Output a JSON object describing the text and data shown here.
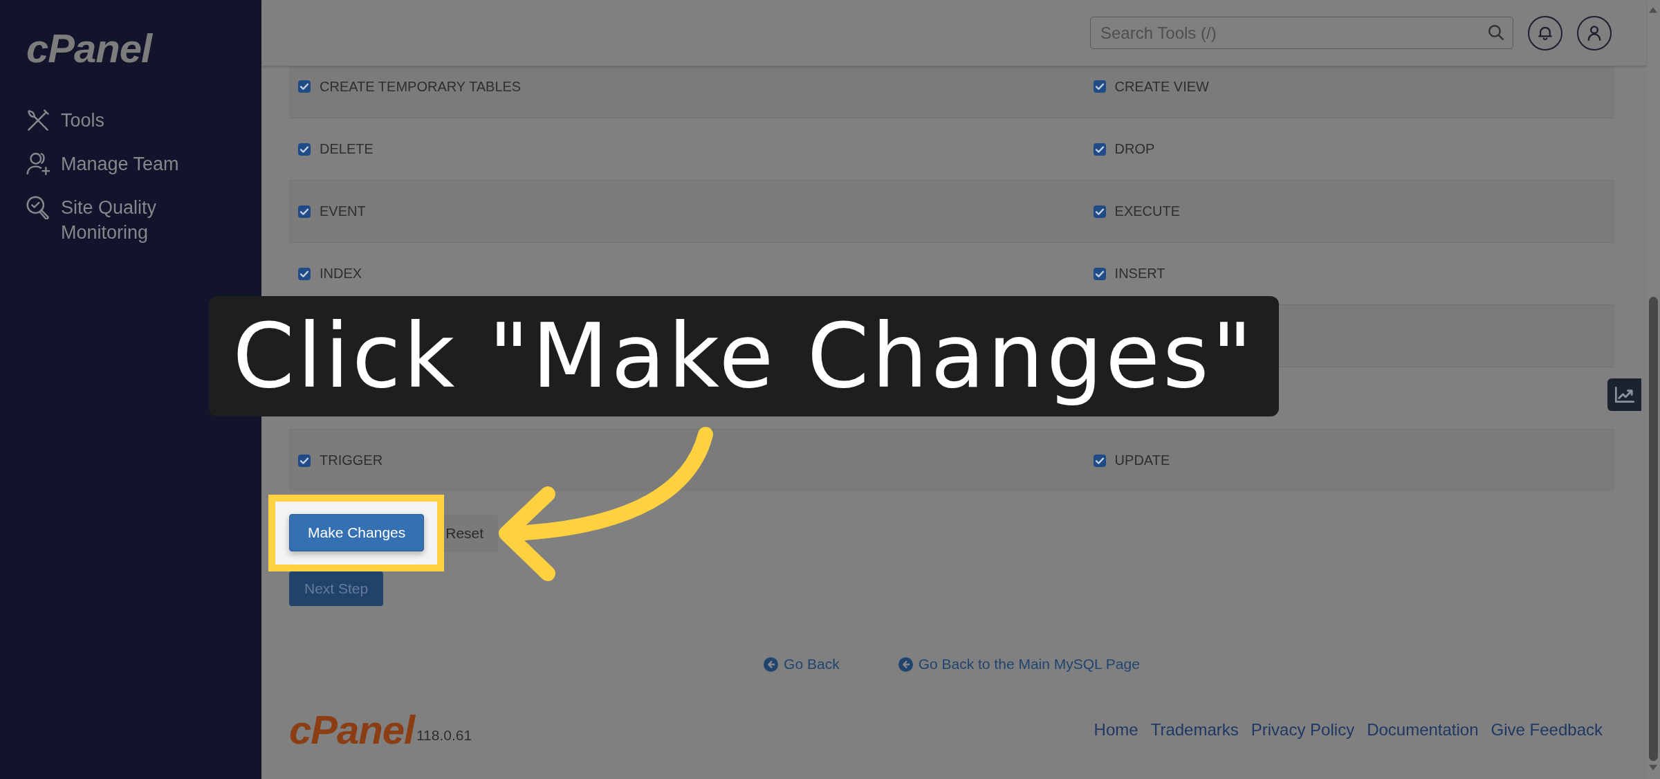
{
  "sidebar": {
    "logo": "cPanel",
    "items": [
      {
        "label": "Tools",
        "selected": false
      },
      {
        "label": "Manage Team",
        "selected": false
      },
      {
        "label": "Site Quality Monitoring",
        "selected": false
      }
    ]
  },
  "header": {
    "search": {
      "placeholder": "Search Tools (/)"
    }
  },
  "permissions": [
    {
      "kind": "pair",
      "cells": [
        {
          "label": "CREATE TEMPORARY TABLES",
          "checked": true
        },
        {
          "label": "CREATE VIEW",
          "checked": true
        }
      ]
    },
    {
      "kind": "pair",
      "cells": [
        {
          "label": "DELETE",
          "checked": true
        },
        {
          "label": "DROP",
          "checked": true
        }
      ]
    },
    {
      "kind": "pair",
      "cells": [
        {
          "label": "EVENT",
          "checked": true
        },
        {
          "label": "EXECUTE",
          "checked": true
        }
      ]
    },
    {
      "kind": "pair",
      "cells": [
        {
          "label": "INDEX",
          "checked": true
        },
        {
          "label": "INSERT",
          "checked": true
        }
      ]
    },
    {
      "kind": "covered"
    },
    {
      "kind": "covered"
    },
    {
      "kind": "pair",
      "cells": [
        {
          "label": "TRIGGER",
          "checked": true
        },
        {
          "label": "UPDATE",
          "checked": true
        }
      ]
    }
  ],
  "callout": {
    "text": "Click \"Make Changes\""
  },
  "actions": [
    {
      "label": "Make Changes",
      "kind": "primary",
      "highlighted": true
    },
    {
      "label": "Reset",
      "kind": "secondary",
      "highlighted": false
    }
  ],
  "next_step": {
    "label": "Next Step"
  },
  "back_links": [
    {
      "label": "Go Back"
    },
    {
      "label": "Go Back to the Main MySQL Page"
    }
  ],
  "footer": {
    "logo": "cPanel",
    "version": "118.0.61",
    "links": [
      "Home",
      "Trademarks",
      "Privacy Policy",
      "Documentation",
      "Give Feedback"
    ]
  }
}
